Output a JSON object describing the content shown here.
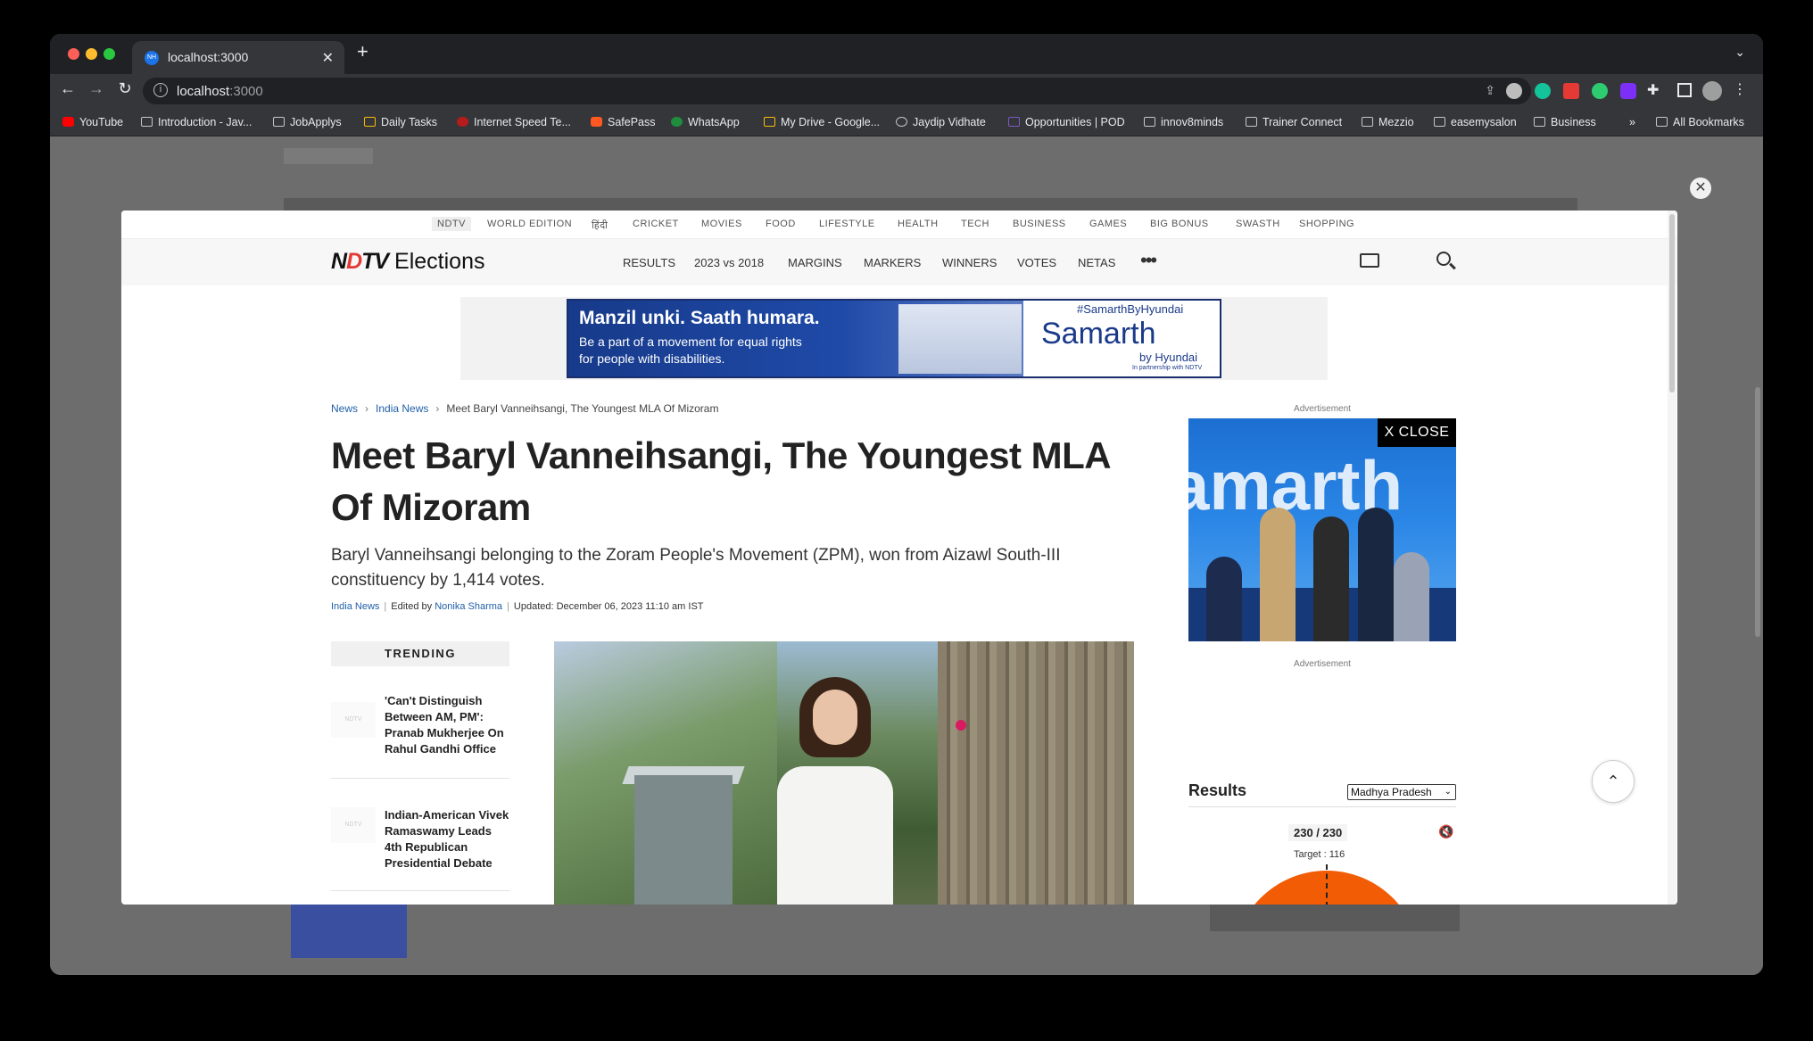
{
  "browser": {
    "tab_title": "localhost:3000",
    "tab_favicon_text": "NH",
    "url_host": "localhost",
    "url_port": ":3000",
    "bookmarks": [
      {
        "label": "YouTube",
        "icon": "youtube-icon"
      },
      {
        "label": "Introduction - Jav...",
        "icon": "m-icon"
      },
      {
        "label": "JobApplys",
        "icon": "folder-icon"
      },
      {
        "label": "Daily Tasks",
        "icon": "google-drive-icon"
      },
      {
        "label": "Internet Speed Te...",
        "icon": "speed-icon"
      },
      {
        "label": "SafePass",
        "icon": "shield-icon"
      },
      {
        "label": "WhatsApp",
        "icon": "whatsapp-icon"
      },
      {
        "label": "My Drive - Google...",
        "icon": "google-drive-icon"
      },
      {
        "label": "Jaydip Vidhate",
        "icon": "jv-icon"
      },
      {
        "label": "Opportunities | POD",
        "icon": "pod-icon"
      },
      {
        "label": "innov8minds",
        "icon": "folder-icon"
      },
      {
        "label": "Trainer Connect",
        "icon": "folder-icon"
      },
      {
        "label": "Mezzio",
        "icon": "folder-icon"
      },
      {
        "label": "easemysalon",
        "icon": "folder-icon"
      },
      {
        "label": "Business",
        "icon": "folder-icon"
      }
    ],
    "bookmarks_overflow": "»",
    "all_bookmarks": "All Bookmarks"
  },
  "site": {
    "top_nav": [
      "NDTV",
      "WORLD EDITION",
      "हिंदी",
      "CRICKET",
      "MOVIES",
      "FOOD",
      "LIFESTYLE",
      "HEALTH",
      "TECH",
      "BUSINESS",
      "GAMES",
      "BIG BONUS",
      "SWASTH",
      "SHOPPING"
    ],
    "logo_brand_pre": "N",
    "logo_brand_red": "D",
    "logo_brand_post": "TV",
    "logo_section": "Elections",
    "main_nav": [
      "RESULTS",
      "2023 vs 2018",
      "MARGINS",
      "MARKERS",
      "WINNERS",
      "VOTES",
      "NETAS"
    ],
    "more": "•••"
  },
  "banner": {
    "headline": "Manzil unki.  Saath humara.",
    "line1": "Be a part of a movement for equal rights",
    "line2": "for people with disabilities.",
    "hashtag": "#SamarthByHyundai",
    "brand": "Samarth",
    "by": "by Hyundai",
    "partner": "In partnership with NDTV"
  },
  "article": {
    "breadcrumb": [
      "News",
      "India News",
      "Meet Baryl Vanneihsangi, The Youngest MLA Of Mizoram"
    ],
    "headline": "Meet Baryl Vanneihsangi, The Youngest MLA Of Mizoram",
    "summary": "Baryl Vanneihsangi belonging to the Zoram People's Movement (ZPM), won from Aizawl South-III constituency by 1,414 votes.",
    "category": "India News",
    "edited_by_label": "Edited by",
    "editor": "Nonika Sharma",
    "updated": "Updated: December 06, 2023 11:10 am IST"
  },
  "trending": {
    "title": "TRENDING",
    "thumb_text": "NDTV",
    "items": [
      "'Can't Distinguish Between AM, PM': Pranab Mukherjee On Rahul Gandhi Office",
      "Indian-American Vivek Ramaswamy Leads 4th Republican Presidential Debate"
    ]
  },
  "sidebar": {
    "ad_label": "Advertisement",
    "ad_close": "X CLOSE",
    "ad_word": "amarth",
    "ad_label_2": "Advertisement",
    "results_title": "Results",
    "state_selected": "Madhya Pradesh",
    "count": "230  / 230",
    "target": "Target : 116"
  },
  "colors": {
    "accent_red": "#e53935",
    "link_blue": "#1f5fa8",
    "gauge_orange": "#f25c05"
  }
}
